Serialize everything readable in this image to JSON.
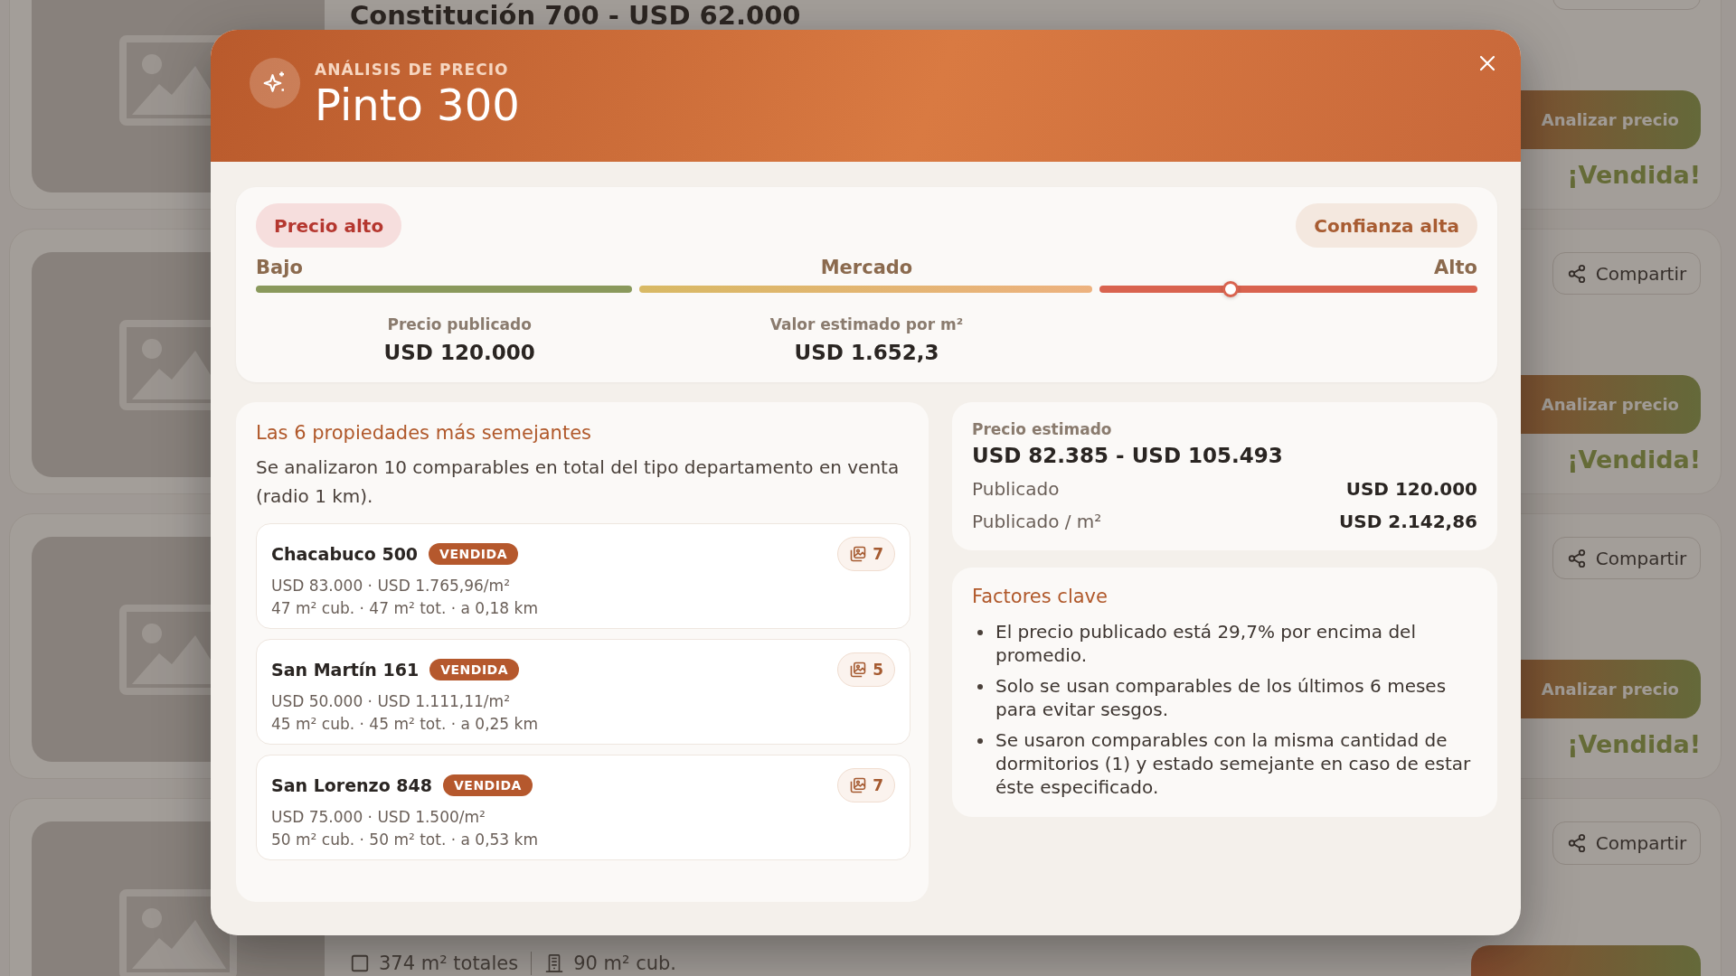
{
  "listings": [
    {
      "title": "Constitución 700 - USD 62.000",
      "analyze_label": "Analizar precio",
      "sold": "¡Vendida!"
    },
    {
      "share_label": "Compartir",
      "analyze_label": "Analizar precio",
      "sold": "¡Vendida!"
    },
    {
      "share_label": "Compartir",
      "analyze_label": "Analizar precio",
      "sold": "¡Vendida!"
    },
    {
      "features": [
        {
          "kind": "area",
          "text": "374 m² totales"
        },
        {
          "kind": "covered",
          "text": "90 m² cub."
        }
      ],
      "share_label": "Compartir"
    }
  ],
  "modal": {
    "eyebrow": "ANÁLISIS DE PRECIO",
    "title": "Pinto 300",
    "summary": {
      "verdict": "Precio alto",
      "confidence": "Confianza alta",
      "scale": {
        "labels": [
          "Bajo",
          "Mercado",
          "Alto"
        ],
        "level": 0.797
      },
      "stats": [
        {
          "label": "Precio publicado",
          "value": "USD 120.000"
        },
        {
          "label": "Valor estimado por m²",
          "value": "USD 1.652,3"
        }
      ]
    },
    "comparables": {
      "title": "Las 6 propiedades más semejantes",
      "description": "Se analizaron 10 comparables en total del tipo departamento en venta (radio 1 km).",
      "items": [
        {
          "name": "Chacabuco 500",
          "badge": "VENDIDA",
          "photos": "7",
          "price_line": "USD 83.000 · USD 1.765,96/m²",
          "size_line": "47 m² cub. · 47 m² tot. · a 0,18 km"
        },
        {
          "name": "San Martín 161",
          "badge": "VENDIDA",
          "photos": "5",
          "price_line": "USD 50.000 · USD 1.111,11/m²",
          "size_line": "45 m² cub. · 45 m² tot. · a 0,25 km"
        },
        {
          "name": "San Lorenzo 848",
          "badge": "VENDIDA",
          "photos": "7",
          "price_line": "USD 75.000 · USD 1.500/m²",
          "size_line": "50 m² cub. · 50 m² tot. · a 0,53 km"
        }
      ]
    },
    "estimate": {
      "label": "Precio estimado",
      "range": "USD 82.385 - USD 105.493",
      "rows": [
        {
          "label": "Publicado",
          "value": "USD 120.000"
        },
        {
          "label": "Publicado / m²",
          "value": "USD 2.142,86"
        }
      ]
    },
    "factors": {
      "title": "Factores clave",
      "items": [
        "El precio publicado está 29,7% por encima del promedio.",
        "Solo se usan comparables de los últimos 6 meses para evitar sesgos.",
        "Se usaron comparables con la misma cantidad de dormitorios (1) y estado semejante en caso de estar éste especificado."
      ]
    }
  }
}
